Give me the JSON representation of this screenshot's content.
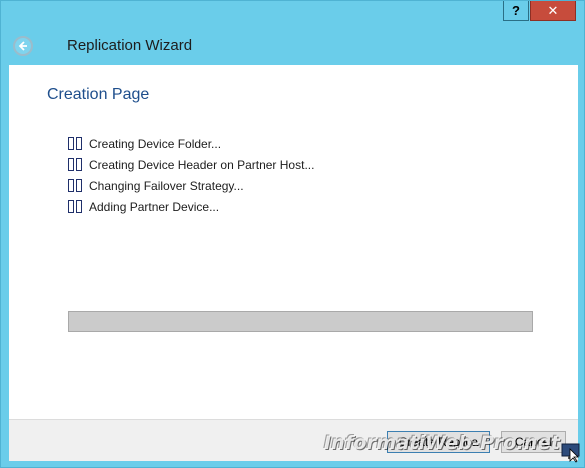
{
  "window": {
    "title": "Replication Wizard",
    "help_label": "?",
    "close_label": "✕"
  },
  "page": {
    "heading": "Creation Page"
  },
  "steps": [
    {
      "label": "Creating Device Folder..."
    },
    {
      "label": "Creating Device Header on Partner Host..."
    },
    {
      "label": "Changing Failover Strategy..."
    },
    {
      "label": "Adding Partner Device..."
    }
  ],
  "progress": {
    "value": 0
  },
  "buttons": {
    "create_label": "Create Replica",
    "cancel_label": "Cancel"
  },
  "watermark": {
    "text": "InformatiWeb-Pro.net"
  },
  "colors": {
    "title_bar": "#6acdea",
    "heading": "#1e4e8c",
    "close": "#c74c3c"
  }
}
